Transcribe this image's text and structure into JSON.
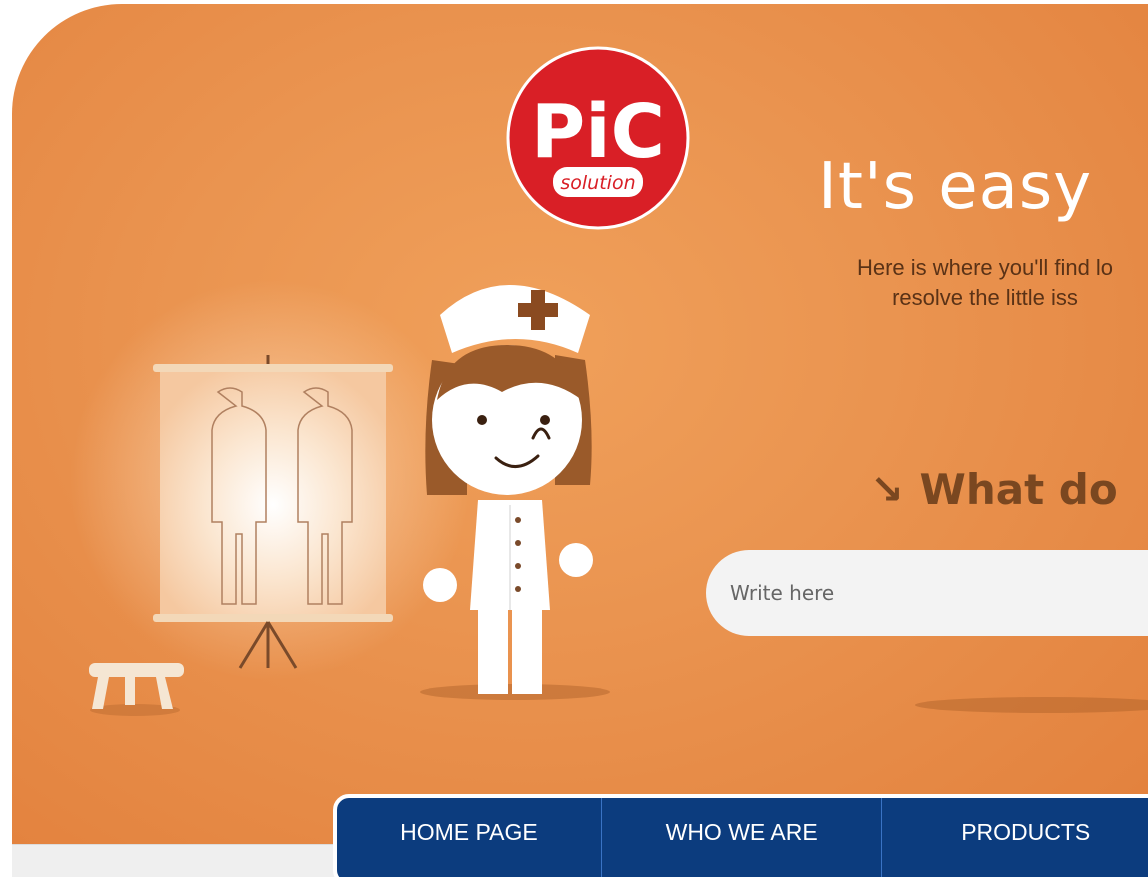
{
  "brand": {
    "logo_main": "PiC",
    "logo_sub": "solution",
    "logo_color": "#d91f26"
  },
  "hero": {
    "headline": "It's easy",
    "subtext_line1": "Here is where you'll find lo",
    "subtext_line2": "resolve the little iss",
    "question": "What do",
    "question_arrow": "↘",
    "background_color": "#ea9450"
  },
  "search": {
    "placeholder": "Write here",
    "value": ""
  },
  "nav": {
    "items": [
      {
        "label": "HOME PAGE"
      },
      {
        "label": "WHO WE ARE"
      },
      {
        "label": "PRODUCTS"
      }
    ],
    "color": "#0c3c7e"
  }
}
